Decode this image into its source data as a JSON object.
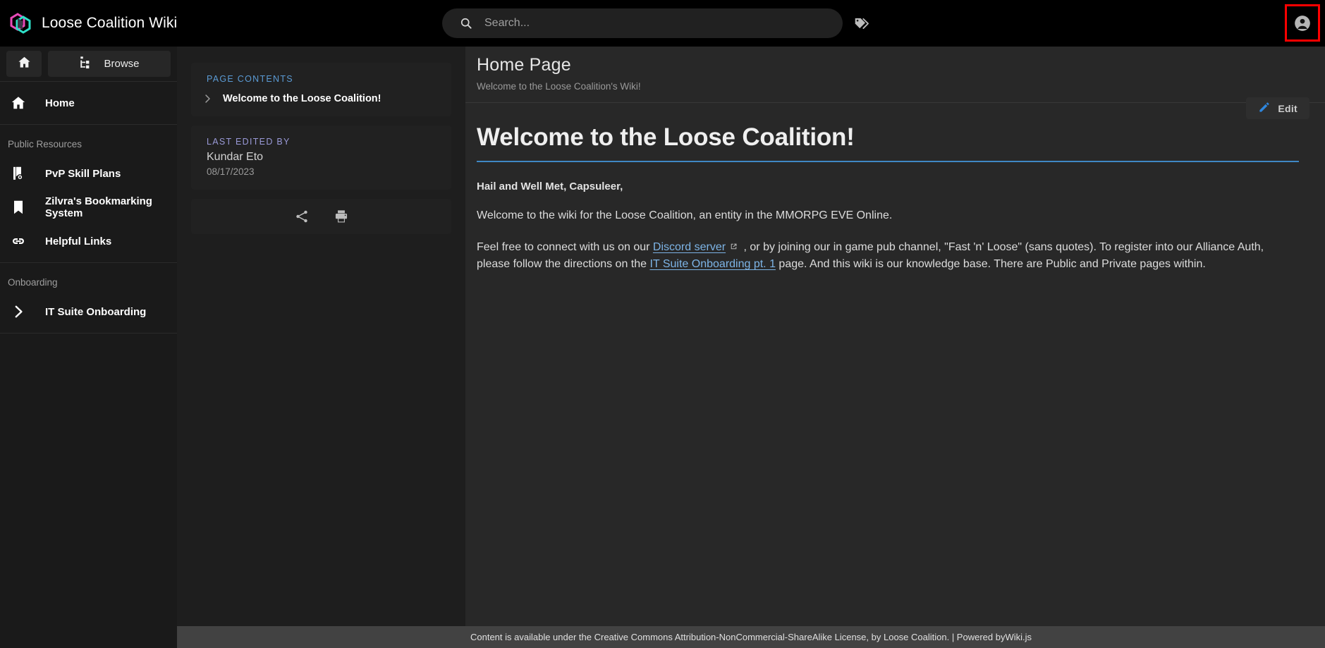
{
  "topbar": {
    "logo_icon": "wikijs-hexagon-logo",
    "brand_title": "Loose Coalition Wiki",
    "search": {
      "icon": "search-icon",
      "placeholder": "Search...",
      "value": ""
    },
    "tags_icon": "tags-icon",
    "account_icon": "account-circle-icon",
    "highlight_color": "#ff0000"
  },
  "sidebar": {
    "home_button_icon": "home-icon",
    "browse_button": {
      "icon": "file-tree-icon",
      "label": "Browse"
    },
    "nav": [
      {
        "icon": "home-icon",
        "label": "Home"
      }
    ],
    "groups": [
      {
        "label": "Public Resources",
        "items": [
          {
            "icon": "book-skill-icon",
            "label": "PvP Skill Plans"
          },
          {
            "icon": "bookmark-icon",
            "label": "Zilvra's Bookmarking System"
          },
          {
            "icon": "link-icon",
            "label": "Helpful Links"
          }
        ]
      },
      {
        "label": "Onboarding",
        "items": [
          {
            "icon": "chevron-right-icon",
            "label": "IT Suite Onboarding"
          }
        ]
      }
    ]
  },
  "midcol": {
    "toc": {
      "caption": "PAGE CONTENTS",
      "caption_color": "#5b9bd5",
      "entries": [
        {
          "icon": "chevron-right-icon",
          "title": "Welcome to the Loose Coalition!"
        }
      ]
    },
    "last_edited": {
      "caption": "LAST EDITED BY",
      "caption_color": "#9a9ad8",
      "author": "Kundar Eto",
      "date": "08/17/2023"
    },
    "actions": [
      {
        "icon": "share-icon",
        "name": "share-button"
      },
      {
        "icon": "print-icon",
        "name": "print-button"
      }
    ]
  },
  "main": {
    "page_title": "Home Page",
    "page_subtitle": "Welcome to the Loose Coalition's Wiki!",
    "edit_button": {
      "icon": "pencil-icon",
      "label": "Edit",
      "icon_color": "#2e86de"
    },
    "article": {
      "heading": "Welcome to the Loose Coalition!",
      "heading_rule_color": "#3f88c5",
      "lead": "Hail and Well Met, Capsuleer,",
      "paragraph1": "Welcome to the wiki for the Loose Coalition, an entity in the MMORPG EVE Online.",
      "paragraph2": {
        "part1": "Feel free to connect with us on our ",
        "link1": "Discord server",
        "external_icon": "open-in-new-icon",
        "part2": " , or by joining our in game pub channel, \"Fast 'n' Loose\" (sans quotes). To register into our Alliance Auth, please follow the directions on the ",
        "link2": "IT Suite Onboarding pt. 1",
        "part3": " page. And this wiki is our knowledge base. There are Public and Private pages within."
      }
    }
  },
  "footer": {
    "text": "Content is available under the Creative Commons Attribution-NonCommercial-ShareAlike License, by Loose Coalition. | Powered by ",
    "link": "Wiki.js"
  }
}
